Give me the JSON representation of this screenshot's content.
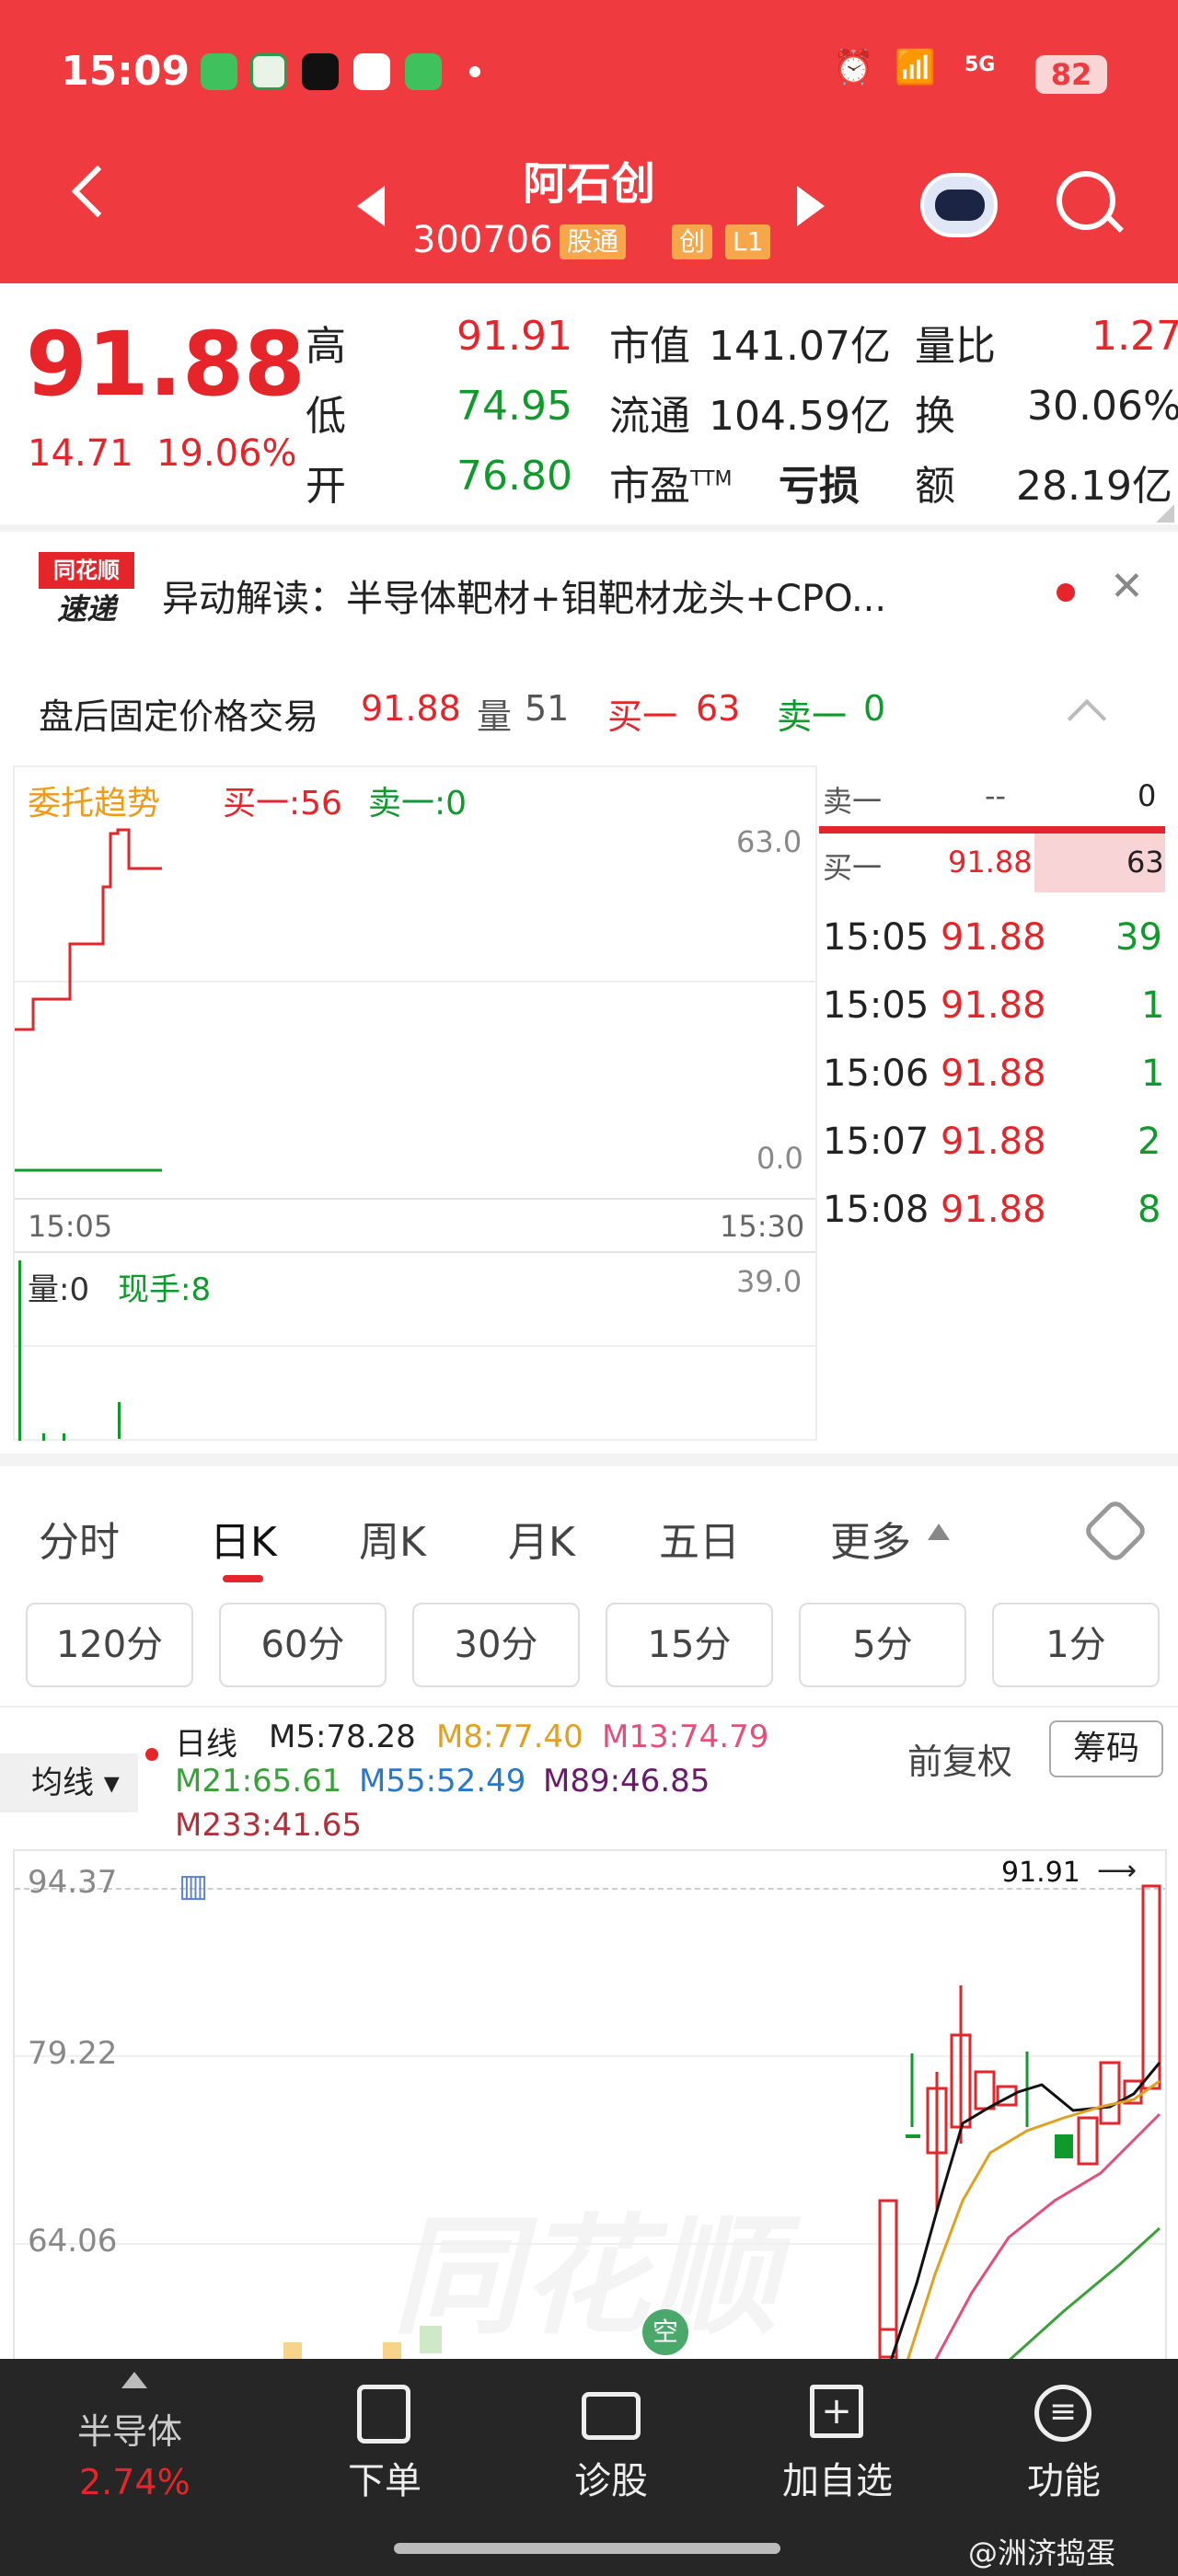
{
  "status_bar": {
    "time": "15:09",
    "battery": "82",
    "network": "5G"
  },
  "header": {
    "title": "阿石创",
    "code": "300706",
    "tags": [
      "股通",
      "创",
      "L1"
    ]
  },
  "quote": {
    "price": "91.88",
    "change": "14.71",
    "change_pct": "19.06%",
    "rows": [
      {
        "l1": "高",
        "v1": "91.91",
        "l2": "市值",
        "v2": "141.07亿",
        "l3": "量比",
        "v3": "1.27"
      },
      {
        "l1": "低",
        "v1": "74.95",
        "l2": "流通",
        "v2": "104.59亿",
        "l3": "换",
        "v3": "30.06%"
      },
      {
        "l1": "开",
        "v1": "76.80",
        "l2": "市盈",
        "l2sup": "TTM",
        "v2": "亏损",
        "l3": "额",
        "v3": "28.19亿"
      }
    ]
  },
  "news": {
    "logo_top": "同花顺",
    "logo_bottom": "速递",
    "text": "异动解读：半导体靶材+钼靶材龙头+CPO..."
  },
  "after_hours": {
    "label": "盘后固定价格交易",
    "price": "91.88",
    "vol_label": "量",
    "vol": "51",
    "buy_label": "买一",
    "buy": "63",
    "sell_label": "卖一",
    "sell": "0"
  },
  "mini_chart": {
    "title": "委托趋势",
    "buy": "买一:56",
    "sell": "卖一:0",
    "y_top": "63.0",
    "y_bottom": "0.0",
    "x_left": "15:05",
    "x_right": "15:30",
    "vol_label": "量:0",
    "hand_label": "现手:8",
    "vol_top": "39.0"
  },
  "order_book": {
    "sell": {
      "label": "卖一",
      "price": "--",
      "qty": "0"
    },
    "buy": {
      "label": "买一",
      "price": "91.88",
      "qty": "63"
    },
    "trades": [
      {
        "time": "15:05",
        "price": "91.88",
        "qty": "39"
      },
      {
        "time": "15:05",
        "price": "91.88",
        "qty": "1"
      },
      {
        "time": "15:06",
        "price": "91.88",
        "qty": "1"
      },
      {
        "time": "15:07",
        "price": "91.88",
        "qty": "2"
      },
      {
        "time": "15:08",
        "price": "91.88",
        "qty": "8"
      }
    ]
  },
  "tabs": [
    "分时",
    "日K",
    "周K",
    "月K",
    "五日",
    "更多"
  ],
  "period_tabs": [
    "120分",
    "60分",
    "30分",
    "15分",
    "5分",
    "1分"
  ],
  "kline": {
    "indicator": "均线",
    "ma_labels": {
      "day": "日线",
      "m5": "M5:78.28",
      "m8": "M8:77.40",
      "m13": "M13:74.79",
      "m21": "M21:65.61",
      "m55": "M55:52.49",
      "m89": "M89:46.85",
      "m233": "M233:41.65"
    },
    "fq": "前复权",
    "chip": "筹码",
    "y_labels": [
      "94.37",
      "79.22",
      "64.06"
    ],
    "high_label": "91.91",
    "watermark": "同花顺",
    "badge": "空"
  },
  "chart_data": {
    "type": "candlestick",
    "y_ticks": [
      94.37,
      79.22,
      64.06
    ],
    "high": 91.91,
    "ma_values": {
      "M5": 78.28,
      "M8": 77.4,
      "M13": 74.79,
      "M21": 65.61,
      "M55": 52.49,
      "M89": 46.85,
      "M233": 41.65
    }
  },
  "nav": {
    "sector": "半导体",
    "sector_pct": "2.74%",
    "items": [
      {
        "label": "下单"
      },
      {
        "label": "诊股"
      },
      {
        "label": "加自选"
      },
      {
        "label": "功能"
      }
    ]
  },
  "watermark_text": "@洲济捣蛋"
}
